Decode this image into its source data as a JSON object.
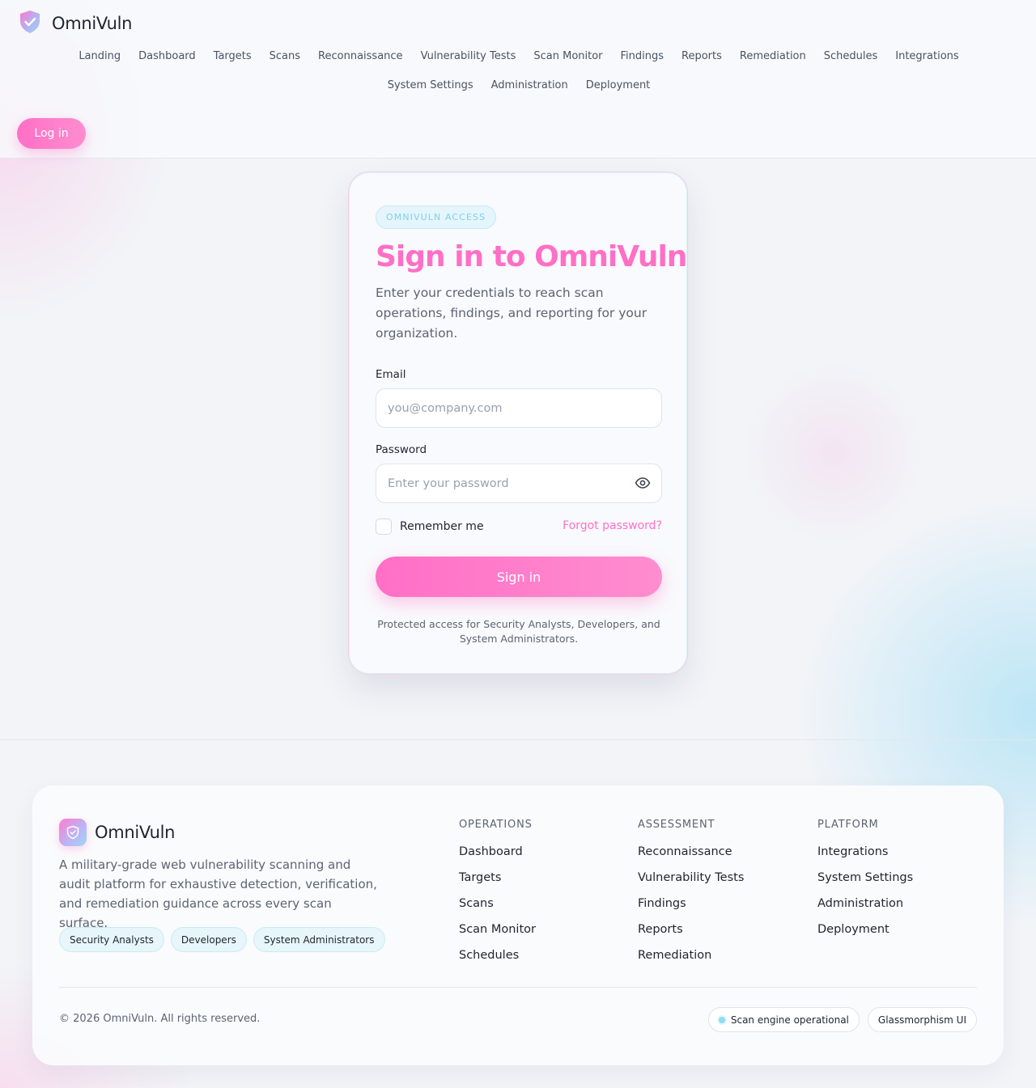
{
  "brand": {
    "name": "OmniVuln"
  },
  "nav": {
    "items": [
      {
        "label": "Landing"
      },
      {
        "label": "Dashboard"
      },
      {
        "label": "Targets"
      },
      {
        "label": "Scans"
      },
      {
        "label": "Reconnaissance"
      },
      {
        "label": "Vulnerability Tests"
      },
      {
        "label": "Scan Monitor"
      },
      {
        "label": "Findings"
      },
      {
        "label": "Reports"
      },
      {
        "label": "Remediation"
      },
      {
        "label": "Schedules"
      },
      {
        "label": "Integrations"
      },
      {
        "label": "System Settings"
      },
      {
        "label": "Administration"
      },
      {
        "label": "Deployment"
      }
    ],
    "login_label": "Log in"
  },
  "login": {
    "eyebrow": "OMNIVULN ACCESS",
    "title": "Sign in to OmniVuln",
    "subtitle": "Enter your credentials to reach scan operations, findings, and reporting for your organization.",
    "email_label": "Email",
    "email_placeholder": "you@company.com",
    "email_value": "",
    "password_label": "Password",
    "password_placeholder": "Enter your password",
    "password_value": "",
    "remember_label": "Remember me",
    "remember_checked": false,
    "forgot_label": "Forgot password?",
    "submit_label": "Sign in",
    "note": "Protected access for Security Analysts, Developers, and System Administrators."
  },
  "footer": {
    "brand_name": "OmniVuln",
    "description": "A military-grade web vulnerability scanning and audit platform for exhaustive detection, verification, and remediation guidance across every scan surface.",
    "tags": [
      "Security Analysts",
      "Developers",
      "System Administrators"
    ],
    "columns": [
      {
        "title": "OPERATIONS",
        "links": [
          "Dashboard",
          "Targets",
          "Scans",
          "Scan Monitor",
          "Schedules"
        ]
      },
      {
        "title": "ASSESSMENT",
        "links": [
          "Reconnaissance",
          "Vulnerability Tests",
          "Findings",
          "Reports",
          "Remediation"
        ]
      },
      {
        "title": "PLATFORM",
        "links": [
          "Integrations",
          "System Settings",
          "Administration",
          "Deployment"
        ]
      }
    ],
    "copyright": "© 2026 OmniVuln. All rights reserved.",
    "status_label": "Scan engine operational",
    "theme_label": "Glassmorphism UI"
  },
  "colors": {
    "accent": "#ff6fc6",
    "accent_light": "#ff8dcf",
    "info": "#7fd1ec",
    "text": "#1f2430",
    "muted": "#5c6373"
  },
  "icons": {
    "brand_logo": "shield-check-icon",
    "password_toggle": "eye-icon",
    "status_dot": "status-dot-icon"
  }
}
